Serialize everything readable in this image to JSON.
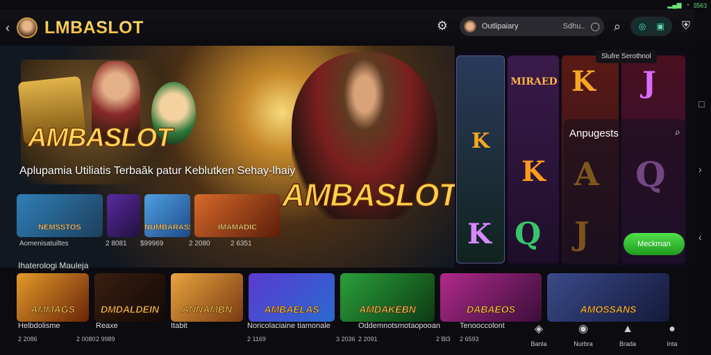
{
  "status": {
    "right_text": "ﾛ56ﾖ"
  },
  "header": {
    "brand": "LMBASLOT",
    "user_name": "Outlipaiary",
    "user_balance": "Sdhu..",
    "tooltip": "Slufre Serothnol"
  },
  "hero": {
    "logo_small": "AMBASLOT",
    "logo_big": "AMBASLOT",
    "tagline": "Aplupamia Utiliatis Terbaăk patur Keblutken Sehay-lhaiy"
  },
  "mini_tiles": [
    {
      "title": "NEMSSTOS",
      "badge": ""
    },
    {
      "title": "",
      "badge": ""
    },
    {
      "title": "NUMBARASS",
      "badge": ""
    },
    {
      "title": "IMAMADIC",
      "badge": ""
    }
  ],
  "mini_info": [
    "Aomenisatuiltes",
    "2 8081",
    "$99969",
    "2 2080",
    "2 6351"
  ],
  "reels": {
    "panel_title": "Anpugests",
    "panel_button": "Meckman",
    "symbol_labels": [
      "MIRAED",
      "K",
      "J",
      "K",
      "A",
      "Q",
      "K",
      "J",
      "K",
      "Q"
    ]
  },
  "section_title": "Ihaterologi Mauleja",
  "cards": [
    {
      "title": "AMMAGS",
      "info": "Helbdolisme",
      "sub": "2 2086",
      "badge": ""
    },
    {
      "title": "DMDALDEIN",
      "info": "Reaxe",
      "sub": "2 9989",
      "badge": ""
    },
    {
      "title": "ANNAMBN",
      "info": "Itabit",
      "sub": "",
      "badge": ""
    },
    {
      "title": "AMBAELAS",
      "info": "Noricolaciaine tiamonale",
      "sub": "2 1169",
      "badge": ""
    },
    {
      "title": "AMDAKEBN",
      "info": "Oddemnotsmotaopooan",
      "sub": "2 2091",
      "badge": ""
    },
    {
      "title": "DABAEOS",
      "info": "Tenooccolont",
      "sub": "2 6593",
      "badge": ""
    },
    {
      "title": "AMOSSANS",
      "info": "",
      "sub": "",
      "badge": ""
    }
  ],
  "card_right_values": [
    "2 0080",
    "3 2036",
    "2 Bl3"
  ],
  "bottom_nav": [
    {
      "icon": "cards-icon",
      "label": "Banla"
    },
    {
      "icon": "target-icon",
      "label": "Nurbra"
    },
    {
      "icon": "trophy-icon",
      "label": "Brada"
    },
    {
      "icon": "user-icon",
      "label": "Inta"
    }
  ],
  "colors": {
    "brand_gold": "#f5c542",
    "accent_green": "#3bc43a",
    "badge_red": "#d62828"
  }
}
